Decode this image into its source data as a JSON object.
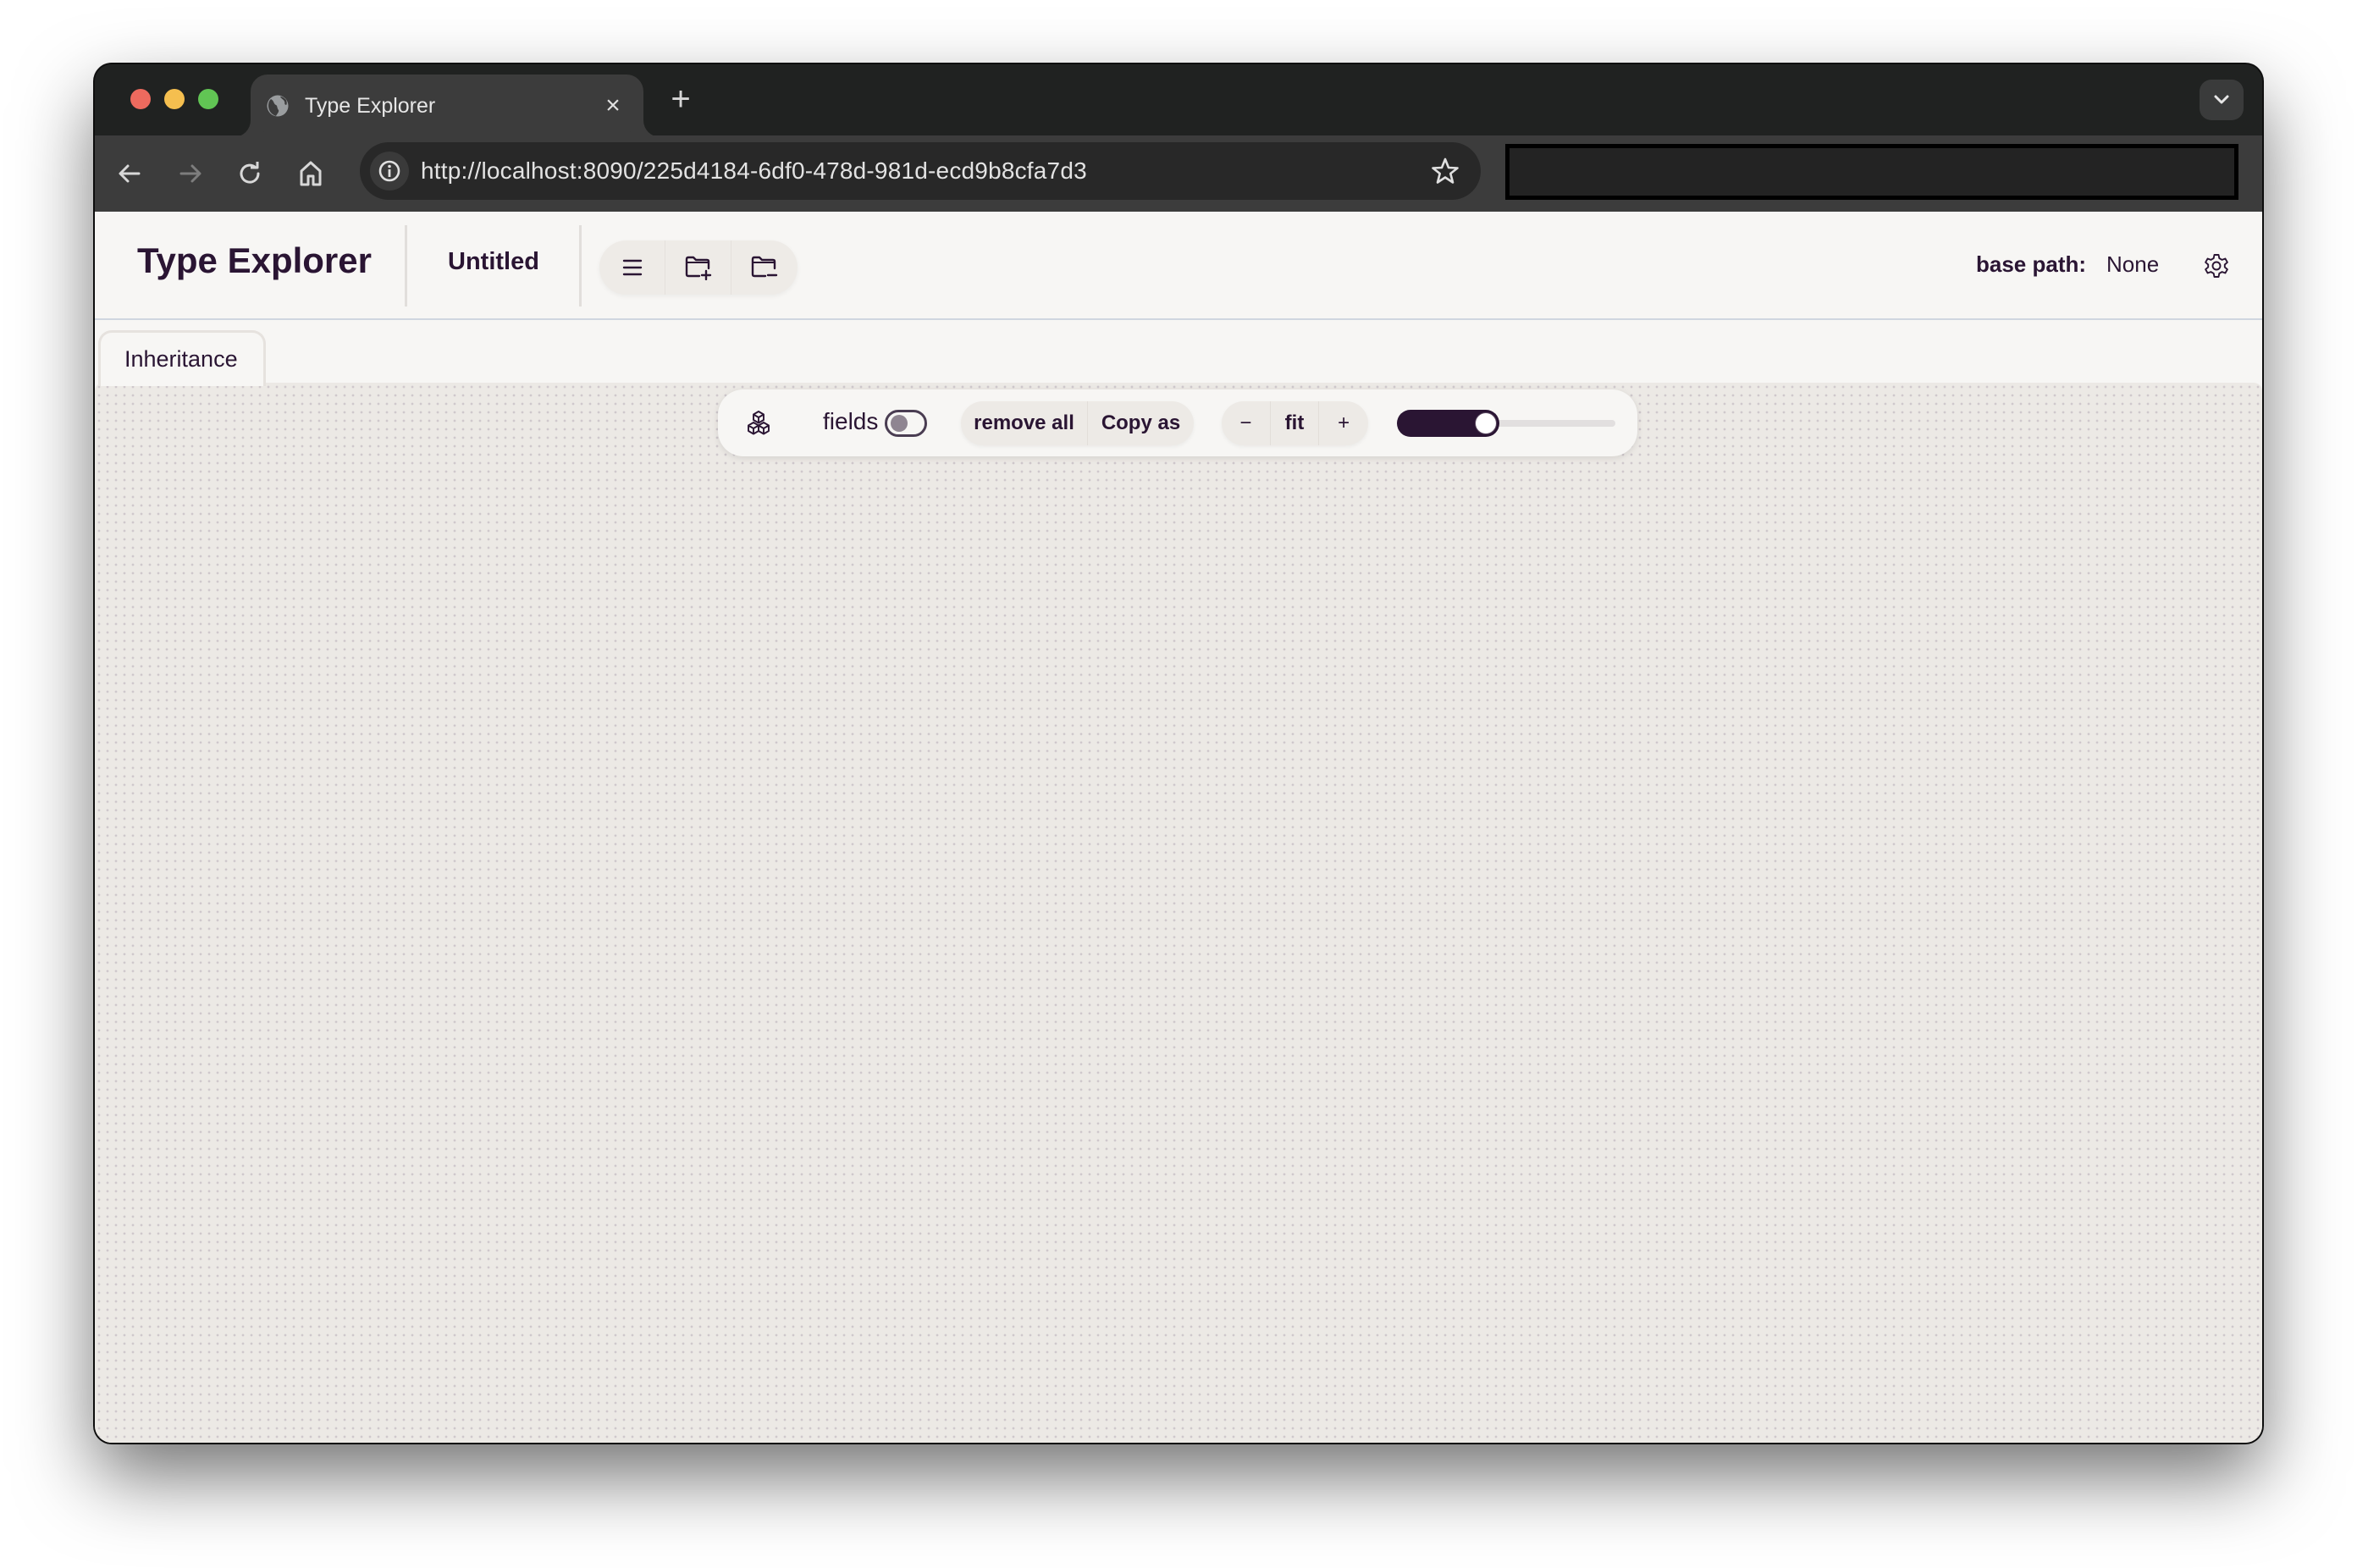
{
  "browser": {
    "tab": {
      "title": "Type Explorer",
      "favicon": "globe-icon",
      "close_glyph": "×"
    },
    "new_tab_glyph": "+",
    "url": "http://localhost:8090/225d4184-6df0-478d-981d-ecd9b8cfa7d3",
    "nav_icons": [
      "back-arrow-icon",
      "forward-arrow-icon",
      "reload-icon",
      "home-icon"
    ],
    "traffic_colors": {
      "close": "#ed6a5e",
      "minimize": "#f5bf4f",
      "zoom": "#61c554"
    }
  },
  "header": {
    "app_title": "Type Explorer",
    "doc_title": "Untitled",
    "icon_buttons": [
      "menu-icon",
      "folder-add-icon",
      "folder-remove-icon"
    ],
    "base_path_label": "base path:",
    "base_path_value": "None",
    "settings_icon": "gear-icon"
  },
  "view_tabs": [
    {
      "label": "Inheritance",
      "active": true
    }
  ],
  "graph_toolbar": {
    "cube_icon": "cubes-icon",
    "fields_label": "fields",
    "fields_enabled": false,
    "remove_all_label": "remove all",
    "copy_as_label": "Copy as",
    "zoom_out_label": "−",
    "fit_label": "fit",
    "zoom_in_label": "+",
    "slider_value": 0.2
  },
  "colors": {
    "accent": "#2a1533",
    "canvas_bg": "#ece9e5",
    "header_bg": "#f7f6f4"
  }
}
